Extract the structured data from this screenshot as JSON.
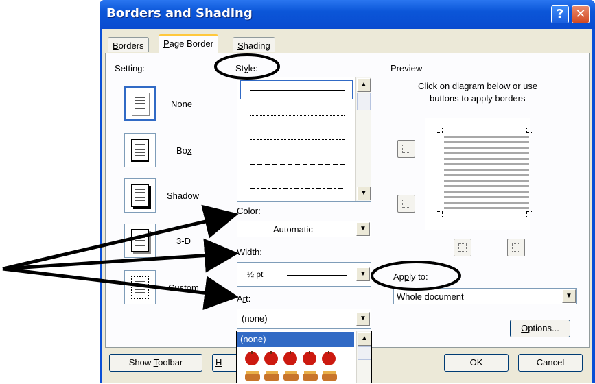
{
  "dialog": {
    "title": "Borders and Shading",
    "help_label": "?",
    "close_label": "✕"
  },
  "tabs": [
    {
      "label": "Borders",
      "accel": "B",
      "rest": "orders"
    },
    {
      "label": "Page Border",
      "accel": "P",
      "rest": "age Border"
    },
    {
      "label": "Shading",
      "accel": "S",
      "rest": "hading"
    }
  ],
  "setting": {
    "label": "Setting:",
    "options": [
      {
        "label": "None",
        "accel": "N",
        "rest": "one",
        "pre": ""
      },
      {
        "label": "Box",
        "accel": "x",
        "pre": "Bo",
        "rest": ""
      },
      {
        "label": "Shadow",
        "accel": "a",
        "pre": "Sh",
        "rest": "dow"
      },
      {
        "label": "3-D",
        "accel": "D",
        "pre": "3-",
        "rest": ""
      },
      {
        "label": "Custom",
        "accel": "",
        "pre": "Custom",
        "rest": ""
      }
    ]
  },
  "style": {
    "label_pre": "St",
    "label_accel": "y",
    "label_post": "le:"
  },
  "color": {
    "label_accel": "C",
    "label_post": "olor:",
    "value": "Automatic"
  },
  "width": {
    "label_accel": "W",
    "label_post": "idth:",
    "value": "½ pt"
  },
  "art": {
    "label_pre": "A",
    "label_accel": "r",
    "label_post": "t:",
    "value": "(none)",
    "dropdown_selected": "(none)"
  },
  "preview": {
    "label": "Preview",
    "instruction_line1": "Click on diagram below or use",
    "instruction_line2": "buttons to apply borders"
  },
  "apply_to": {
    "label_pre": "Ap",
    "label_accel": "p",
    "label_post": "ly to:",
    "value": "Whole document"
  },
  "buttons": {
    "options_accel": "O",
    "options_rest": "ptions...",
    "show_toolbar_pre": "Show ",
    "show_toolbar_accel": "T",
    "show_toolbar_post": "oolbar",
    "hidden_partial": "H",
    "ok": "OK",
    "cancel": "Cancel"
  },
  "colors": {
    "title_bar": "#0a4fd6",
    "dialog_face": "#ece9d8",
    "selection": "#316ac5",
    "arrow": "#000000"
  }
}
